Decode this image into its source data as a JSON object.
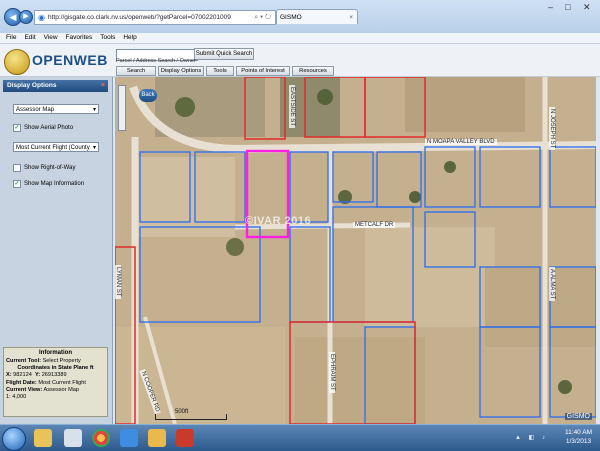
{
  "browser": {
    "url": "http://gisgate.co.clark.nv.us/openweb/?getParcel=07002201009",
    "tab_title": "GISMO",
    "window_controls": [
      "–",
      "□",
      "✕"
    ],
    "nav_back": "◀",
    "nav_forward": "▶"
  },
  "menu": [
    "File",
    "Edit",
    "View",
    "Favorites",
    "Tools",
    "Help"
  ],
  "app": {
    "logo_text": "OPENWEB",
    "search": {
      "placeholder": "",
      "button": "Submit Quick Search",
      "hint": "Parcel / Address Search / Owner"
    },
    "nav": [
      "Search",
      "Display Options",
      "Tools",
      "Points of Interest",
      "Resources"
    ]
  },
  "sidebar": {
    "title": "Display Options",
    "map_type": "Assessor Map",
    "show_aerial": {
      "label": "Show Aerial Photo",
      "checked": true
    },
    "flight": "Most Current Flight (County",
    "show_row": {
      "label": "Show Right-of-Way",
      "checked": false
    },
    "show_info": {
      "label": "Show Map Information",
      "checked": true
    },
    "info": {
      "title": "Information",
      "current_tool_label": "Current Tool:",
      "current_tool": "Select Property",
      "coords_title": "Coordinates in State Plane ft",
      "x_label": "X:",
      "x": "982124",
      "y_label": "Y:",
      "y": "26913389",
      "flight_label": "Flight Date:",
      "flight": "Most Current Flight",
      "view_label": "Current View:",
      "view": "Assessor Map",
      "scale": "1: 4,000"
    }
  },
  "map": {
    "back_label": "Back",
    "roads": {
      "moapa_valley": "N MOAPA VALLEY BLVD",
      "metcalf": "METCALF DR",
      "lyman": "LYMAN ST",
      "joseph": "N JOSEPH ST",
      "alma": "A ALMA ST",
      "eastside": "EASTSIDE ST",
      "ephraim": "EPHRAIM ST",
      "cooper": "N COOPER RD"
    },
    "scale_label": "500ft",
    "watermark": "©IVAR 2016",
    "corner_label": "GISMO",
    "colors": {
      "parcel_blue": "#2a6cf0",
      "parcel_red": "#e22a2a",
      "selected": "#ff1fe0"
    }
  },
  "taskbar": {
    "time": "11:40 AM",
    "date": "1/3/2013",
    "tray": "▲ ◧ ♪"
  }
}
